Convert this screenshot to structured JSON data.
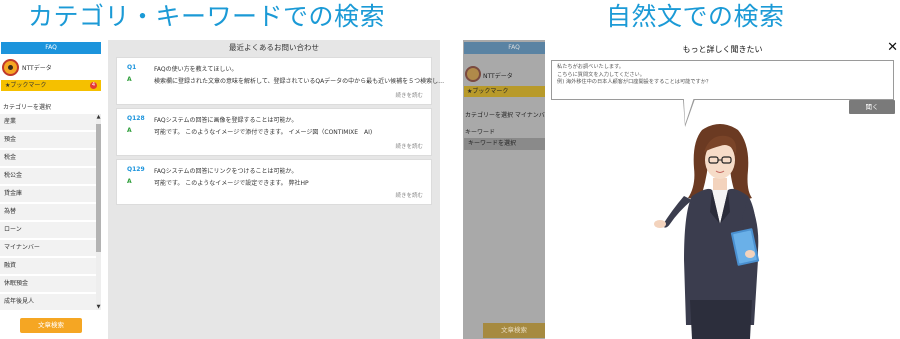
{
  "headings": {
    "left": "カテゴリ・キーワードでの検索",
    "right": "自然文での検索"
  },
  "colors": {
    "heading": "#1b9ad6",
    "faq_bar": "#1c94dc",
    "bookmark": "#f5c000",
    "search_button": "#f5a623",
    "answer_label": "#2e9e3a"
  },
  "left": {
    "sidebar": {
      "faq_label": "FAQ",
      "user_name": "NTTデータ",
      "bookmark_label": "★ブックマーク",
      "bookmark_count": "4",
      "category_title": "カテゴリーを選択",
      "categories": [
        "産業",
        "預金",
        "税金",
        "税公金",
        "貸金庫",
        "為替",
        "ローン",
        "マイナンバー",
        "融資",
        "休眠預金",
        "成年後見人"
      ],
      "search_button": "文章検索"
    },
    "main": {
      "title": "最近よくあるお問い合わせ",
      "items": [
        {
          "q_no": "Q1",
          "question": "FAQの使い方を教えてほしい。",
          "a_label": "A",
          "answer": "検索欄に登録された文章の意味を解析して、登録されているQAデータの中から最も近い候補を５つ検索し…",
          "more": "続きを読む"
        },
        {
          "q_no": "Q128",
          "question": "FAQシステムの回答に画像を登録することは可能か。",
          "a_label": "A",
          "answer": "可能です。 このようなイメージで添付できます。 イメージ図（CONTIMIXE　AI)",
          "more": "続きを読む"
        },
        {
          "q_no": "Q129",
          "question": "FAQシステムの回答にリンクをつけることは可能か。",
          "a_label": "A",
          "answer": "可能です。 このようなイメージで設定できます。 弊社HP",
          "more": "続きを読む"
        }
      ]
    }
  },
  "right": {
    "background": {
      "faq_label": "FAQ",
      "user_name": "NTTデータ",
      "bookmark_label": "★ブックマーク",
      "tabs": "カテゴリーを選択 マイナンバー",
      "keyword_label": "キーワード",
      "keyword_placeholder": "キーワードを選択",
      "search_button": "文章検索"
    },
    "modal": {
      "title": "もっと詳しく聞きたい",
      "close_icon": "close-icon",
      "bubble_line1": "私たちがお調べいたします。",
      "bubble_line2": "こちらに質問文を入力してください。",
      "bubble_line3": "例) 海外移住中の日本人顧客が口座開設をすることは可能ですか？",
      "ask_button": "聞く"
    }
  }
}
